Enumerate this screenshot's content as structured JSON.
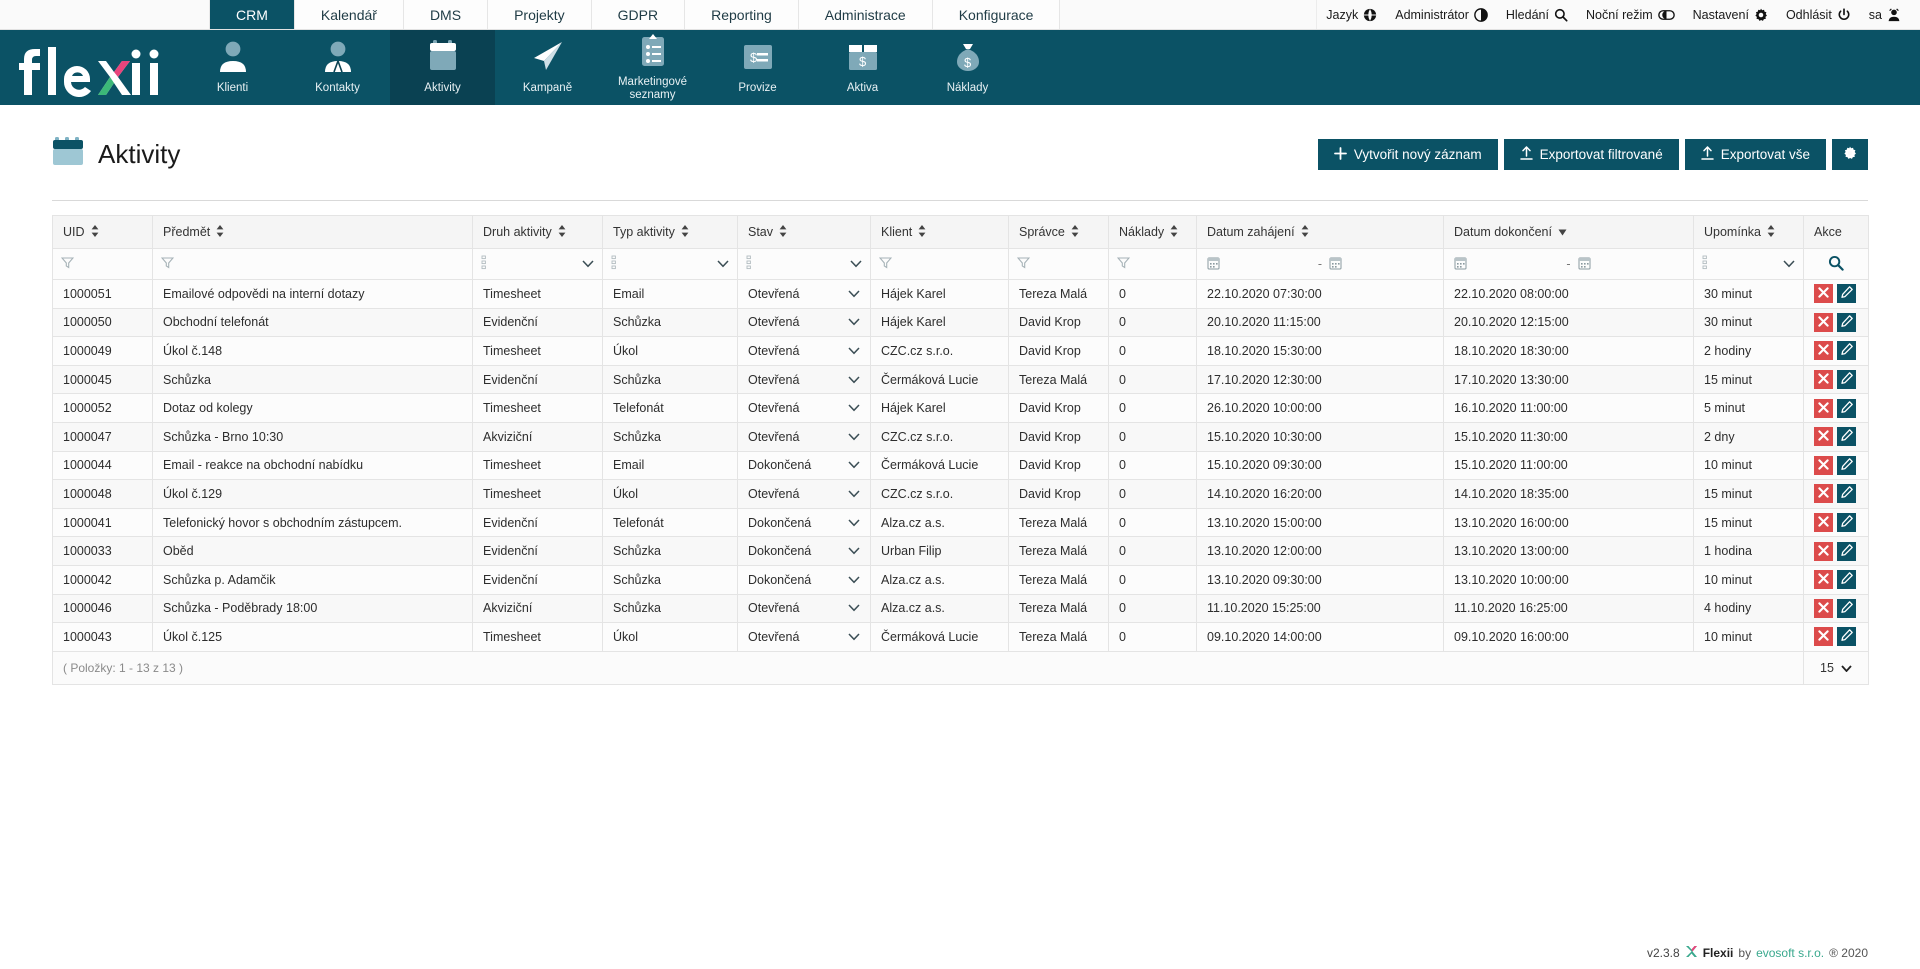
{
  "app": {
    "brand_name": "flexii",
    "accent_dark": "#0b5265",
    "accent_active": "#0a4152",
    "danger": "#dc4b4b"
  },
  "topbar": {
    "tabs": [
      {
        "label": "CRM",
        "active": true
      },
      {
        "label": "Kalendář",
        "active": false
      },
      {
        "label": "DMS",
        "active": false
      },
      {
        "label": "Projekty",
        "active": false
      },
      {
        "label": "GDPR",
        "active": false
      },
      {
        "label": "Reporting",
        "active": false
      },
      {
        "label": "Administrace",
        "active": false
      },
      {
        "label": "Konfigurace",
        "active": false
      }
    ],
    "user_menu": [
      {
        "label": "Jazyk",
        "icon": "globe-icon"
      },
      {
        "label": "Administrátor",
        "icon": "contrast-icon"
      },
      {
        "label": "Hledání",
        "icon": "search-icon"
      },
      {
        "label": "Noční režim",
        "icon": "night-mode-icon"
      },
      {
        "label": "Nastavení",
        "icon": "gear-icon"
      },
      {
        "label": "Odhlásit",
        "icon": "power-icon"
      },
      {
        "label": "sa",
        "icon": "user-avatar-icon"
      }
    ]
  },
  "modules": [
    {
      "label": "Klienti",
      "icon": "person-icon",
      "active": false
    },
    {
      "label": "Kontakty",
      "icon": "contact-icon",
      "active": false
    },
    {
      "label": "Aktivity",
      "icon": "calendar-icon",
      "active": true
    },
    {
      "label": "Kampaně",
      "icon": "paper-plane-icon",
      "active": false
    },
    {
      "label": "Marketingové seznamy",
      "icon": "clipboard-list-icon",
      "active": false
    },
    {
      "label": "Provize",
      "icon": "money-card-icon",
      "active": false
    },
    {
      "label": "Aktiva",
      "icon": "asset-box-icon",
      "active": false
    },
    {
      "label": "Náklady",
      "icon": "money-bag-icon",
      "active": false
    }
  ],
  "page": {
    "title": "Aktivity",
    "title_icon": "calendar-icon",
    "actions": [
      {
        "label": "Vytvořit nový záznam",
        "icon": "plus-icon"
      },
      {
        "label": "Exportovat filtrované",
        "icon": "upload-icon"
      },
      {
        "label": "Exportovat vše",
        "icon": "upload-icon"
      },
      {
        "label": "",
        "icon": "gear-icon"
      }
    ]
  },
  "table": {
    "columns": [
      {
        "label": "UID",
        "sort": "both",
        "filter": "funnel"
      },
      {
        "label": "Předmět",
        "sort": "both",
        "filter": "funnel"
      },
      {
        "label": "Druh aktivity",
        "sort": "both",
        "filter": "select"
      },
      {
        "label": "Typ aktivity",
        "sort": "both",
        "filter": "select"
      },
      {
        "label": "Stav",
        "sort": "both",
        "filter": "select"
      },
      {
        "label": "Klient",
        "sort": "both",
        "filter": "funnel"
      },
      {
        "label": "Správce",
        "sort": "both",
        "filter": "funnel"
      },
      {
        "label": "Náklady",
        "sort": "both",
        "filter": "funnel"
      },
      {
        "label": "Datum zahájení",
        "sort": "both",
        "filter": "daterange"
      },
      {
        "label": "Datum dokončení",
        "sort": "desc",
        "filter": "daterange"
      },
      {
        "label": "Upomínka",
        "sort": "both",
        "filter": "select"
      },
      {
        "label": "Akce",
        "sort": "none",
        "filter": "search"
      }
    ],
    "rows": [
      {
        "uid": "1000051",
        "predmet": "Emailové odpovědi na interní dotazy",
        "druh": "Timesheet",
        "typ": "Email",
        "stav": "Otevřená",
        "klient": "Hájek Karel",
        "spravce": "Tereza Malá",
        "naklady": "0",
        "zahajeni": "22.10.2020 07:30:00",
        "dokonceni": "22.10.2020 08:00:00",
        "upominka": "30 minut"
      },
      {
        "uid": "1000050",
        "predmet": "Obchodní telefonát",
        "druh": "Evidenční",
        "typ": "Schůzka",
        "stav": "Otevřená",
        "klient": "Hájek Karel",
        "spravce": "David Krop",
        "naklady": "0",
        "zahajeni": "20.10.2020 11:15:00",
        "dokonceni": "20.10.2020 12:15:00",
        "upominka": "30 minut"
      },
      {
        "uid": "1000049",
        "predmet": "Úkol č.148",
        "druh": "Timesheet",
        "typ": "Úkol",
        "stav": "Otevřená",
        "klient": "CZC.cz s.r.o.",
        "spravce": "David Krop",
        "naklady": "0",
        "zahajeni": "18.10.2020 15:30:00",
        "dokonceni": "18.10.2020 18:30:00",
        "upominka": "2 hodiny"
      },
      {
        "uid": "1000045",
        "predmet": "Schůzka",
        "druh": "Evidenční",
        "typ": "Schůzka",
        "stav": "Otevřená",
        "klient": "Čermáková Lucie",
        "spravce": "Tereza Malá",
        "naklady": "0",
        "zahajeni": "17.10.2020 12:30:00",
        "dokonceni": "17.10.2020 13:30:00",
        "upominka": "15 minut"
      },
      {
        "uid": "1000052",
        "predmet": "Dotaz od kolegy",
        "druh": "Timesheet",
        "typ": "Telefonát",
        "stav": "Otevřená",
        "klient": "Hájek Karel",
        "spravce": "David Krop",
        "naklady": "0",
        "zahajeni": "26.10.2020 10:00:00",
        "dokonceni": "16.10.2020 11:00:00",
        "upominka": "5 minut"
      },
      {
        "uid": "1000047",
        "predmet": "Schůzka - Brno 10:30",
        "druh": "Akviziční",
        "typ": "Schůzka",
        "stav": "Otevřená",
        "klient": "CZC.cz s.r.o.",
        "spravce": "David Krop",
        "naklady": "0",
        "zahajeni": "15.10.2020 10:30:00",
        "dokonceni": "15.10.2020 11:30:00",
        "upominka": "2 dny"
      },
      {
        "uid": "1000044",
        "predmet": "Email - reakce na obchodní nabídku",
        "druh": "Timesheet",
        "typ": "Email",
        "stav": "Dokončená",
        "klient": "Čermáková Lucie",
        "spravce": "David Krop",
        "naklady": "0",
        "zahajeni": "15.10.2020 09:30:00",
        "dokonceni": "15.10.2020 11:00:00",
        "upominka": "10 minut"
      },
      {
        "uid": "1000048",
        "predmet": "Úkol č.129",
        "druh": "Timesheet",
        "typ": "Úkol",
        "stav": "Otevřená",
        "klient": "CZC.cz s.r.o.",
        "spravce": "David Krop",
        "naklady": "0",
        "zahajeni": "14.10.2020 16:20:00",
        "dokonceni": "14.10.2020 18:35:00",
        "upominka": "15 minut"
      },
      {
        "uid": "1000041",
        "predmet": "Telefonický hovor s obchodním zástupcem.",
        "druh": "Evidenční",
        "typ": "Telefonát",
        "stav": "Dokončená",
        "klient": "Alza.cz a.s.",
        "spravce": "Tereza Malá",
        "naklady": "0",
        "zahajeni": "13.10.2020 15:00:00",
        "dokonceni": "13.10.2020 16:00:00",
        "upominka": "15 minut"
      },
      {
        "uid": "1000033",
        "predmet": "Oběd",
        "druh": "Evidenční",
        "typ": "Schůzka",
        "stav": "Dokončená",
        "klient": "Urban Filip",
        "spravce": "Tereza Malá",
        "naklady": "0",
        "zahajeni": "13.10.2020 12:00:00",
        "dokonceni": "13.10.2020 13:00:00",
        "upominka": "1 hodina"
      },
      {
        "uid": "1000042",
        "predmet": "Schůzka p. Adamčik",
        "druh": "Evidenční",
        "typ": "Schůzka",
        "stav": "Dokončená",
        "klient": "Alza.cz a.s.",
        "spravce": "Tereza Malá",
        "naklady": "0",
        "zahajeni": "13.10.2020 09:30:00",
        "dokonceni": "13.10.2020 10:00:00",
        "upominka": "10 minut"
      },
      {
        "uid": "1000046",
        "predmet": "Schůzka - Poděbrady 18:00",
        "druh": "Akviziční",
        "typ": "Schůzka",
        "stav": "Otevřená",
        "klient": "Alza.cz a.s.",
        "spravce": "Tereza Malá",
        "naklady": "0",
        "zahajeni": "11.10.2020 15:25:00",
        "dokonceni": "11.10.2020 16:25:00",
        "upominka": "4 hodiny"
      },
      {
        "uid": "1000043",
        "predmet": "Úkol č.125",
        "druh": "Timesheet",
        "typ": "Úkol",
        "stav": "Otevřená",
        "klient": "Čermáková Lucie",
        "spravce": "Tereza Malá",
        "naklady": "0",
        "zahajeni": "09.10.2020 14:00:00",
        "dokonceni": "09.10.2020 16:00:00",
        "upominka": "10 minut"
      }
    ],
    "footer": {
      "count_label": "( Položky: 1 - 13 z 13 )",
      "page_size": "15"
    }
  },
  "footer": {
    "version": "v2.3.8",
    "brand": "Flexii",
    "by": "by",
    "vendor": "evosoft s.r.o.",
    "copyright": "® 2020"
  }
}
